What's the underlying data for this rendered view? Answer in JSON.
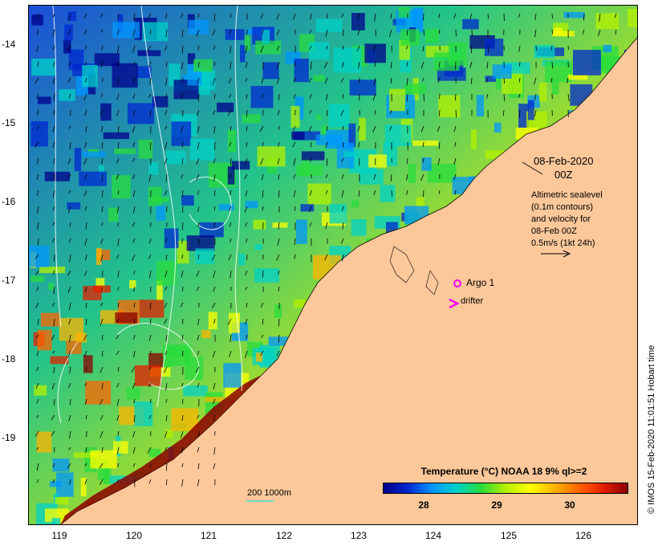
{
  "map": {
    "title_date": "08-Feb-2020",
    "title_time": "00Z",
    "legend_note_lines": [
      "Altimetric sealevel",
      "(0.1m contours)",
      "and velocity for",
      "08-Feb 00Z",
      "0.5m/s (1kt 24h)"
    ],
    "argo_label": "Argo 1",
    "drifter_label": "drifter",
    "depth_label": "200  1000m",
    "credit": "© IMOS 15-Feb-2020 11:01:51 Hobart time",
    "colors": {
      "land": "#fcc89a",
      "argo": "#ff00ff",
      "drifter": "#ff00ff",
      "contour": "#ffffff",
      "depth_contour": "#40e0d0"
    }
  },
  "axes": {
    "lat_ticks": [
      "-14",
      "-15",
      "-16",
      "-17",
      "-18",
      "-19"
    ],
    "lon_ticks": [
      "119",
      "120",
      "121",
      "122",
      "123",
      "124",
      "125",
      "126"
    ]
  },
  "colorbar": {
    "title": "Temperature (°C) NOAA 18 9% ql>=2",
    "ticks": [
      "28",
      "29",
      "30"
    ]
  }
}
